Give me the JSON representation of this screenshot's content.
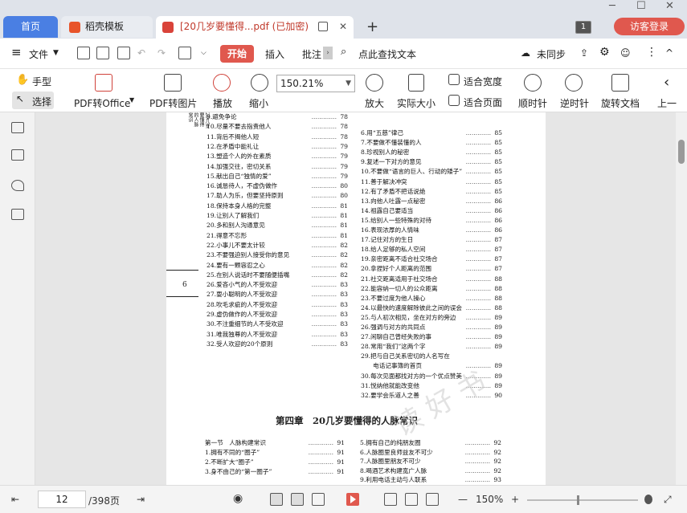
{
  "tabs": {
    "home": "首页",
    "template": "稻壳模板",
    "pdf": "[20几岁要懂得...pdf (已加密)",
    "add": "+"
  },
  "window": {
    "minimize": "─",
    "restore": "☐",
    "close": "✕",
    "count": "1",
    "visitor_login": "访客登录"
  },
  "menu": {
    "hamburger": "≡",
    "file": "文件",
    "start": "开始",
    "insert": "插入",
    "annotate": "批注",
    "search": "点此查找文本",
    "sync": "未同步",
    "more": "⋮",
    "collapse": "^"
  },
  "toolbar": {
    "hand": "手型",
    "select": "选择",
    "pdf_to_office": "PDF转Office",
    "pdf_to_image": "PDF转图片",
    "play": "播放",
    "zoom_out": "缩小",
    "zoom_value": "150.21%",
    "zoom_in": "放大",
    "actual_size": "实际大小",
    "fit_width": "适合宽度",
    "fit_page": "适合页面",
    "rotate_cw": "顺时针",
    "rotate_ccw": "逆时针",
    "rotate_doc": "旋转文档",
    "prev": "上一"
  },
  "document": {
    "page_number_label": "6",
    "side_title": "20几岁要懂得的人脉常识",
    "left_column": [
      {
        "t": "9.避免争论",
        "p": "78"
      },
      {
        "t": "10.尽量不要去指责他人",
        "p": "78"
      },
      {
        "t": "11.背后不揭他人短",
        "p": "78"
      },
      {
        "t": "12.在矛盾中能礼让",
        "p": "79"
      },
      {
        "t": "13.塑造个人的外在素质",
        "p": "79"
      },
      {
        "t": "14.加强交往，密切关系",
        "p": "79"
      },
      {
        "t": "15.献出自己“独情的爱”",
        "p": "79"
      },
      {
        "t": "16.诚恳待人，不虚伪做作",
        "p": "80"
      },
      {
        "t": "17.助人为乐，但要坚持原则",
        "p": "80"
      },
      {
        "t": "18.保持本身人格的完整",
        "p": "81"
      },
      {
        "t": "19.让别人了解我们",
        "p": "81"
      },
      {
        "t": "20.多和别人沟通意见",
        "p": "81"
      },
      {
        "t": "21.得意不忘形",
        "p": "81"
      },
      {
        "t": "22.小事儿不要太计较",
        "p": "82"
      },
      {
        "t": "23.不要强迫别人接受你的意见",
        "p": "82"
      },
      {
        "t": "24.要有一颗容忍之心",
        "p": "82"
      },
      {
        "t": "25.在别人说话时不要随便插嘴",
        "p": "82"
      },
      {
        "t": "26.爱吝小气的人不受欢迎",
        "p": "83"
      },
      {
        "t": "27.耍小聪明的人不受欢迎",
        "p": "83"
      },
      {
        "t": "28.吹毛求疵的人不受欢迎",
        "p": "83"
      },
      {
        "t": "29.虚伪做作的人不受欢迎",
        "p": "83"
      },
      {
        "t": "30.不注重细节的人不受欢迎",
        "p": "83"
      },
      {
        "t": "31.唯我独尊的人不受欢迎",
        "p": "83"
      },
      {
        "t": "32.受人欢迎的20个原则",
        "p": "83"
      }
    ],
    "right_column": [
      {
        "t": "6.用“五慈”律己",
        "p": "85"
      },
      {
        "t": "7.不要做不懂装懂的人",
        "p": "85"
      },
      {
        "t": "8.珍视别人的秘密",
        "p": "85"
      },
      {
        "t": "9.复述一下对方的意见",
        "p": "85"
      },
      {
        "t": "10.不要做“语言的巨人、行动的矮子”",
        "p": "85"
      },
      {
        "t": "11.善于解决冲突",
        "p": "85"
      },
      {
        "t": "12.有了矛盾不把话说绝",
        "p": "85"
      },
      {
        "t": "13.向他人吐露一点秘密",
        "p": "86"
      },
      {
        "t": "14.祖露自己要适当",
        "p": "86"
      },
      {
        "t": "15.给别人一些特殊的对待",
        "p": "86"
      },
      {
        "t": "16.表现浓厚的人情味",
        "p": "86"
      },
      {
        "t": "17.记住对方的生日",
        "p": "87"
      },
      {
        "t": "18.给人足够的私人空间",
        "p": "87"
      },
      {
        "t": "19.亲密距离不适合社交场合",
        "p": "87"
      },
      {
        "t": "20.拿捏好个人距离的范围",
        "p": "87"
      },
      {
        "t": "21.社交距离适用于社交场合",
        "p": "88"
      },
      {
        "t": "22.能容纳一切人的公众距离",
        "p": "88"
      },
      {
        "t": "23.不要过度为他人操心",
        "p": "88"
      },
      {
        "t": "24.以最快的速度解除彼此之间的误会",
        "p": "88"
      },
      {
        "t": "25.与人初次相见，坐在对方的旁边",
        "p": "89"
      },
      {
        "t": "26.强调与对方的共同点",
        "p": "89"
      },
      {
        "t": "27.闲聊自己曾经失败的事",
        "p": "89"
      },
      {
        "t": "28.常用“我们”这两个字",
        "p": "89"
      },
      {
        "t": "29.把与自己关系密切的人名写在",
        "p": ""
      },
      {
        "t": "　　电话记事簿的首页",
        "p": "89"
      },
      {
        "t": "30.每次见面都找对方的一个优点赞美",
        "p": "89"
      },
      {
        "t": "31.悦纳他就能改变他",
        "p": "89"
      },
      {
        "t": "32.要学会乐道人之善",
        "p": "90"
      }
    ],
    "chapter_title": "第四章　20几岁要懂得的人脉常识",
    "ch4_left": [
      {
        "t": "第一节　人脉构建常识",
        "p": "91"
      },
      {
        "t": "1.拥有不同的“圈子”",
        "p": "91"
      },
      {
        "t": "2.不断扩大“圈子”",
        "p": "91"
      },
      {
        "t": "3.身不由己的“第一圈子”",
        "p": "91"
      }
    ],
    "ch4_right": [
      {
        "t": "5.拥有自己的纯朋友圈",
        "p": "92"
      },
      {
        "t": "6.人脉圈里良师益友不可少",
        "p": "92"
      },
      {
        "t": "7.人脉圈里朋友不可少",
        "p": "92"
      },
      {
        "t": "8.喝酒艺术构建宽广人脉",
        "p": "92"
      },
      {
        "t": "9.利用电话主动与人联系",
        "p": "93"
      }
    ]
  },
  "status": {
    "current_page": "12",
    "total_pages": "/398页",
    "zoom": "150%"
  }
}
